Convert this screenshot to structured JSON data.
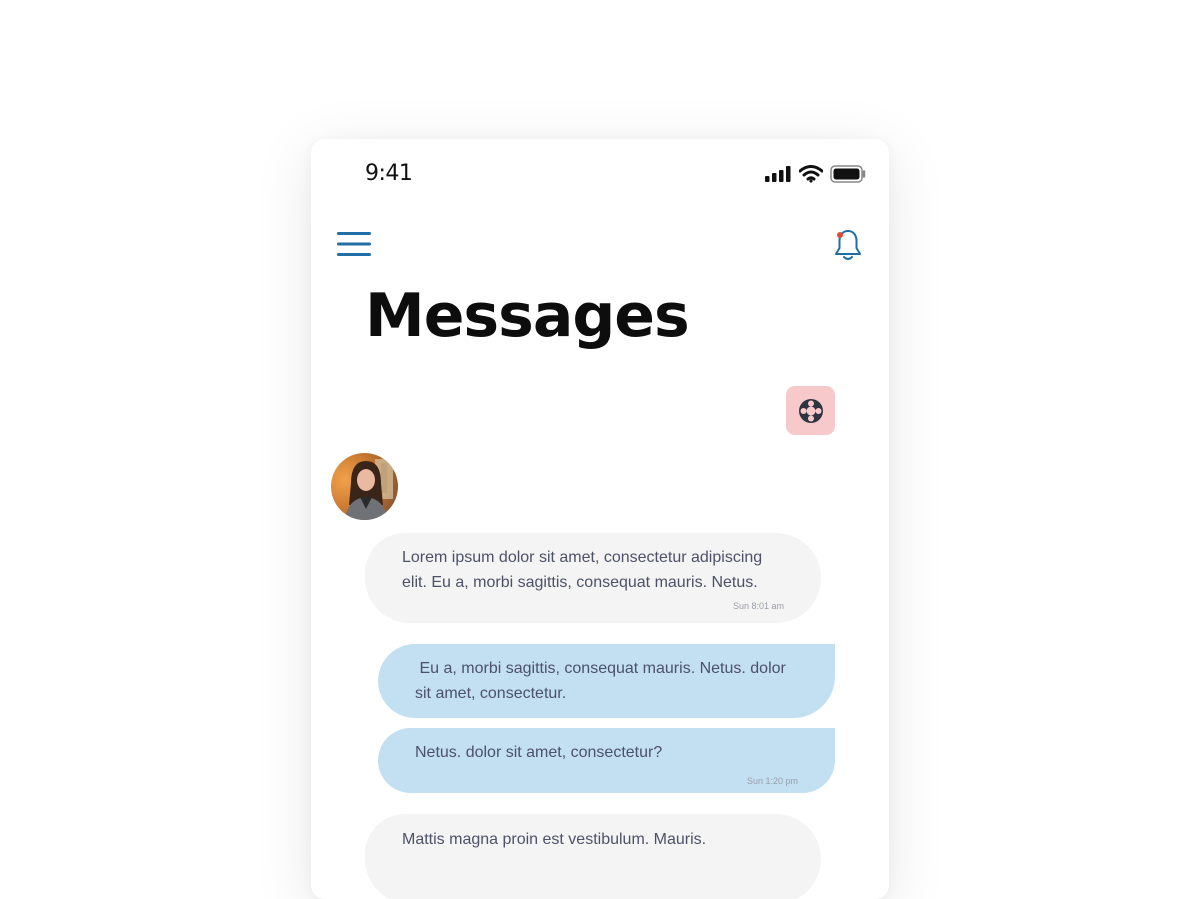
{
  "status_bar": {
    "time": "9:41"
  },
  "header": {
    "title": "Messages"
  },
  "icons": {
    "menu": "hamburger-menu-icon",
    "notifications": "bell-icon",
    "support": "lifebuoy-icon"
  },
  "colors": {
    "accent": "#1f6fa6",
    "incoming_bubble": "#f4f4f4",
    "outgoing_bubble": "#c3e0f2",
    "support_button": "#f8c9ca",
    "notification_dot": "#e04a3a"
  },
  "messages": [
    {
      "direction": "incoming",
      "text": "Lorem ipsum dolor sit amet, consectetur adipiscing elit. Eu a, morbi sagittis, consequat mauris. Netus.",
      "time": "Sun 8:01 am"
    },
    {
      "direction": "outgoing",
      "text": " Eu a, morbi sagittis, consequat mauris. Netus. dolor sit amet, consectetur."
    },
    {
      "direction": "outgoing",
      "text": "Netus. dolor sit amet, consectetur?",
      "time": "Sun 1:20 pm"
    },
    {
      "direction": "incoming",
      "text": "Mattis magna proin est vestibulum. Mauris."
    }
  ]
}
